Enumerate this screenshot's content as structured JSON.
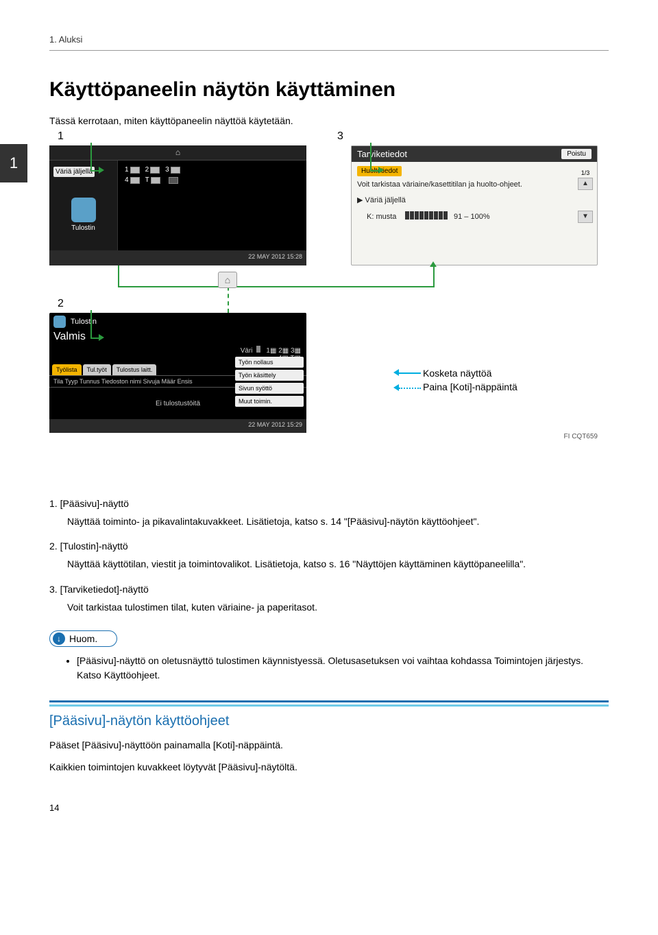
{
  "header": {
    "running": "1. Aluksi"
  },
  "chapter_tab": "1",
  "title": "Käyttöpaneelin näytön käyttäminen",
  "intro": "Tässä kerrotaan, miten käyttöpaneelin näyttöä käytetään.",
  "diagram": {
    "labels": {
      "n1": "1",
      "n2": "2",
      "n3": "3"
    },
    "panel1": {
      "toner_btn": "Väriä jäljellä",
      "printer_label": "Tulostin",
      "trays": [
        "1",
        "2",
        "3",
        "4",
        "T"
      ],
      "timestamp": "22 MAY 2012 15:28"
    },
    "panel3": {
      "title": "Tarviketiedot",
      "exit": "Poistu",
      "selected": "Huoltotiedot",
      "info": "Voit tarkistaa väriaine/kasettitilan ja huolto-ohjeet.",
      "toner_left": "Väriä jäljellä",
      "k_label": "K: musta",
      "percent": "91 – 100%",
      "page": "1/3"
    },
    "panel2": {
      "header": "Tulostin",
      "status": "Valmis",
      "toner_hdr": "Väri",
      "tabs": [
        "Työlista",
        "Tul.työt",
        "Tulostus laitt."
      ],
      "columns": "Tila  Tyyp  Tunnus  Tiedoston nimi Sivuja Määr Ensis",
      "empty": "Ei tulostustöitä",
      "rbtns": [
        "Työn nollaus",
        "Työn käsittely",
        "Sivun syöttö",
        "Muut toimin."
      ],
      "timestamp": "22 MAY 2012 15:29"
    },
    "legend": {
      "touch": "Kosketa näyttöä",
      "home": "Paina [Koti]-näppäintä"
    },
    "code": "FI CQT659"
  },
  "list": [
    {
      "num": "1.",
      "title": "[Pääsivu]-näyttö",
      "desc": "Näyttää toiminto- ja pikavalintakuvakkeet. Lisätietoja, katso s. 14 \"[Pääsivu]-näytön käyttöohjeet\"."
    },
    {
      "num": "2.",
      "title": "[Tulostin]-näyttö",
      "desc": "Näyttää käyttötilan, viestit ja toimintovalikot. Lisätietoja, katso s. 16 \"Näyttöjen käyttäminen käyttöpaneelilla\"."
    },
    {
      "num": "3.",
      "title": "[Tarviketiedot]-näyttö",
      "desc": "Voit tarkistaa tulostimen tilat, kuten väriaine- ja paperitasot."
    }
  ],
  "note": {
    "label": "Huom.",
    "bullets": [
      "[Pääsivu]-näyttö on oletusnäyttö tulostimen käynnistyessä. Oletusasetuksen voi vaihtaa kohdassa Toimintojen järjestys. Katso Käyttöohjeet."
    ]
  },
  "section": {
    "title": "[Pääsivu]-näytön käyttöohjeet",
    "p1": "Pääset [Pääsivu]-näyttöön painamalla [Koti]-näppäintä.",
    "p2": "Kaikkien toimintojen kuvakkeet löytyvät [Pääsivu]-näytöltä."
  },
  "page_number": "14"
}
